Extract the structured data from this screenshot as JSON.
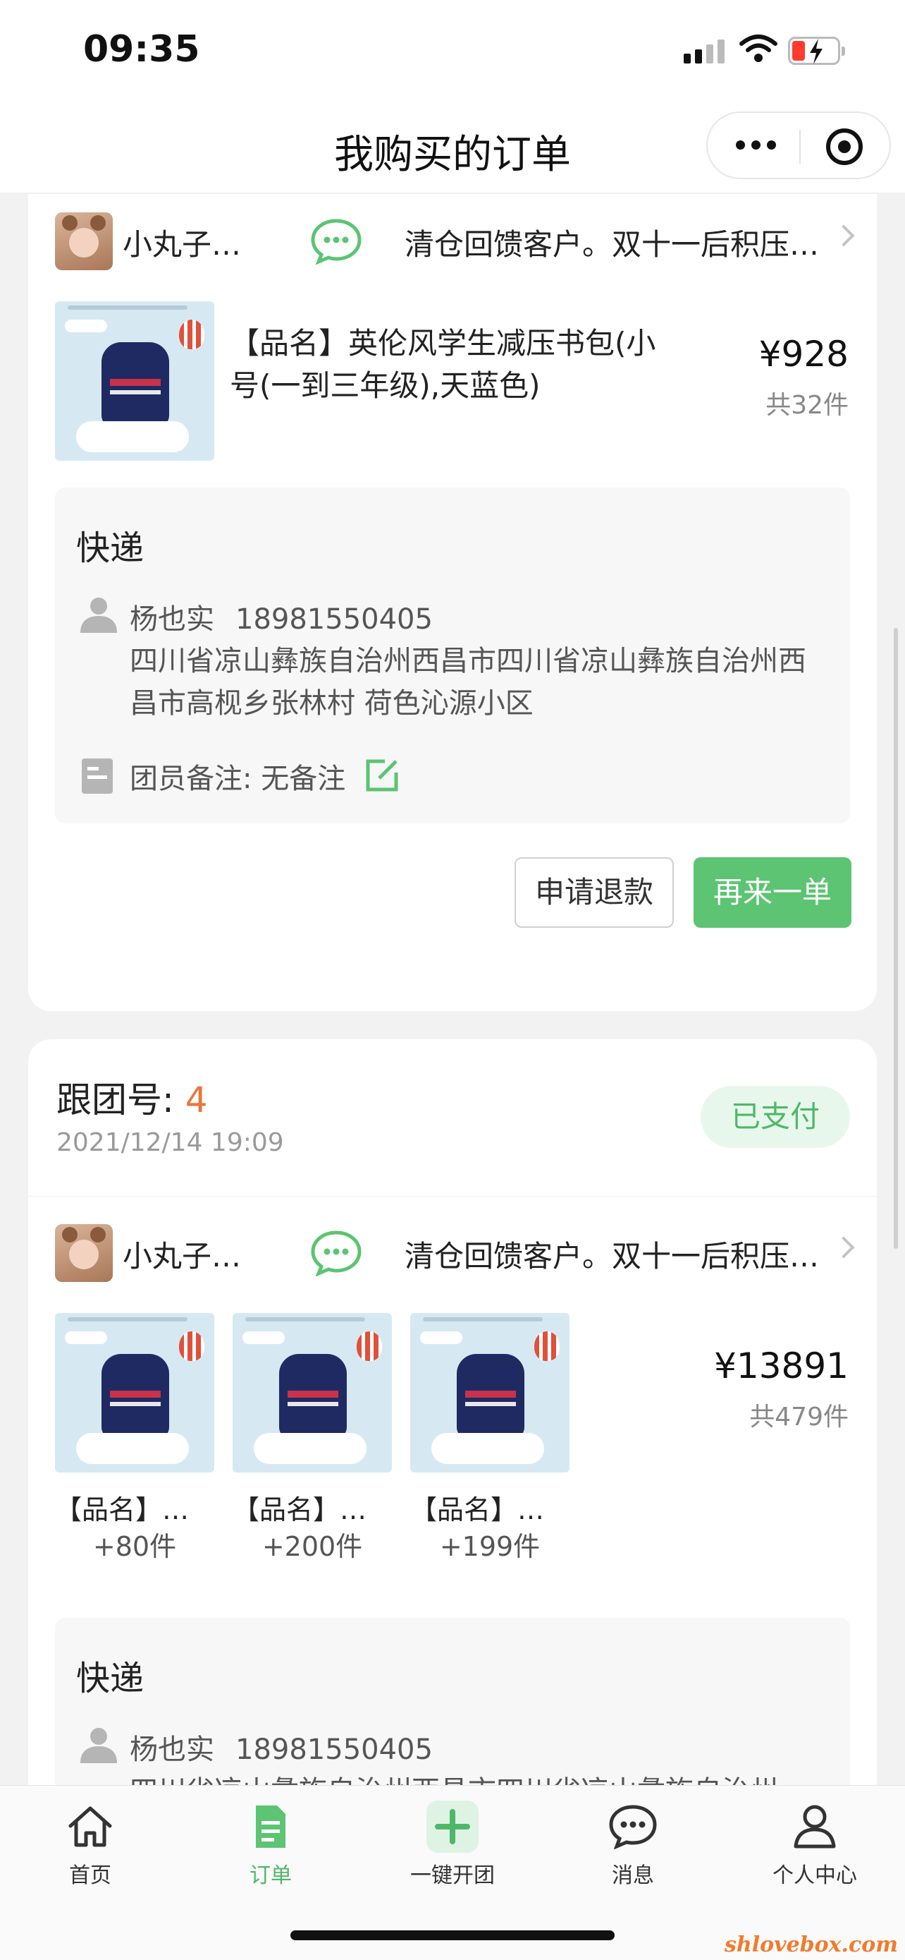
{
  "status_bar": {
    "time": "09:35"
  },
  "nav": {
    "title": "我购买的订单"
  },
  "orders": [
    {
      "leader_name": "小丸子…",
      "group_title": "清仓回馈客户。双十一后积压…",
      "product_name": "【品名】英伦风学生减压书包(小号(一到三年级),天蓝色)",
      "price": "¥928",
      "quantity": "共32件",
      "delivery": {
        "title": "快递",
        "recipient_name": "杨也实",
        "phone": "18981550405",
        "address": "四川省凉山彝族自治州西昌市四川省凉山彝族自治州西昌市高枧乡张林村 荷色沁源小区",
        "note_label": "团员备注:",
        "note_value": "无备注"
      },
      "buttons": {
        "refund": "申请退款",
        "reorder": "再来一单"
      }
    },
    {
      "follow_label": "跟团号: ",
      "follow_number": "4",
      "date": "2021/12/14 19:09",
      "status": "已支付",
      "leader_name": "小丸子…",
      "group_title": "清仓回馈客户。双十一后积压…",
      "items": [
        {
          "label": "【品名】…",
          "count": "+80件"
        },
        {
          "label": "【品名】…",
          "count": "+200件"
        },
        {
          "label": "【品名】…",
          "count": "+199件"
        }
      ],
      "price": "¥13891",
      "quantity": "共479件",
      "delivery": {
        "title": "快递",
        "recipient_name": "杨也实",
        "phone": "18981550405",
        "address": "四川省凉山彝族自治州西昌市四川省凉山彝族自治州"
      }
    }
  ],
  "tabs": [
    {
      "label": "首页",
      "icon": "home-icon"
    },
    {
      "label": "订单",
      "icon": "order-icon",
      "active": true
    },
    {
      "label": "一键开团",
      "icon": "plus-icon"
    },
    {
      "label": "消息",
      "icon": "message-icon"
    },
    {
      "label": "个人中心",
      "icon": "person-icon"
    }
  ],
  "watermark": "shlovebox.com",
  "colors": {
    "accent_green": "#5cc472",
    "follow_number": "#e9753d",
    "battery_low": "#ff3b30"
  }
}
